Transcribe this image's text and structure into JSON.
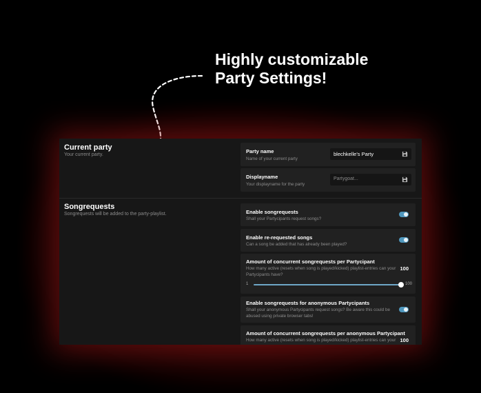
{
  "promo": {
    "headline": "Highly customizable\nParty Settings!"
  },
  "current_party": {
    "title": "Current party",
    "description": "Your current party.",
    "party_name": {
      "label": "Party name",
      "description": "Name of your current party",
      "value": "blechkelle's Party"
    },
    "displayname": {
      "label": "Displayname",
      "description": "Your displayname for the party",
      "placeholder": "Partygoat..."
    }
  },
  "songrequests": {
    "title": "Songrequests",
    "description": "Songrequests will be added to the party-playlist.",
    "enable": {
      "label": "Enable songrequests",
      "description": "Shall your Partycipants request songs?",
      "enabled": true
    },
    "rerequest": {
      "label": "Enable re-requested songs",
      "description": "Can a song be added that has already been played?",
      "enabled": true
    },
    "concurrent": {
      "label": "Amount of concurrent songrequests per Partycipant",
      "description": "How many active (resets when song is played/kicked) playlist-entries can your Partycipants have?",
      "value": "100",
      "slider_min": "1",
      "slider_max": "100",
      "slider_level": 1.0
    },
    "anonymous": {
      "label": "Enable songrequests for anonymous Partycipants",
      "description": "Shall your anonymous Partycipants request songs? Be aware this could be abused using private browser tabs!",
      "enabled": true
    },
    "anon_concurrent": {
      "label": "Amount of concurrent songrequests per anonymous Partycipant",
      "description": "How many active (resets when song is played/kicked) playlist-entries can your",
      "value": "100"
    }
  },
  "colors": {
    "accent": "#4f97bd",
    "panel": "#171717",
    "card": "#212121"
  },
  "icons": {
    "save": "floppy-disk-icon",
    "arrow": "dashed-curved-arrow-icon"
  }
}
